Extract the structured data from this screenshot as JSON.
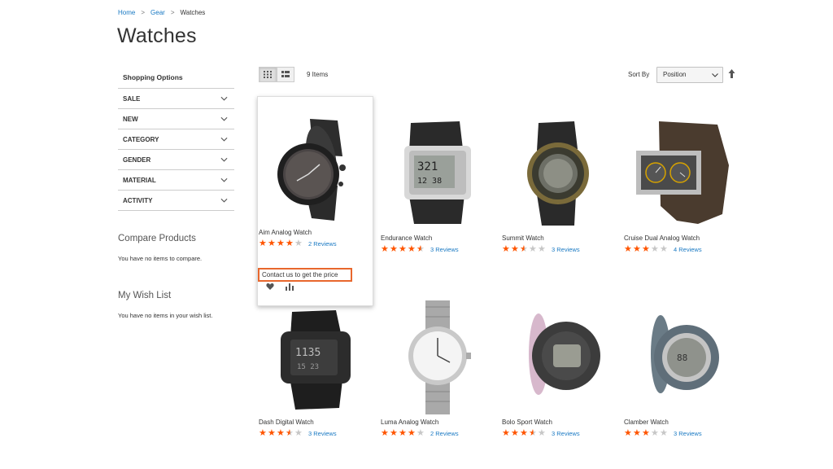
{
  "breadcrumb": {
    "home": "Home",
    "gear": "Gear",
    "current": "Watches",
    "separator": ">"
  },
  "page_title": "Watches",
  "sidebar": {
    "title": "Shopping Options",
    "filters": [
      "SALE",
      "NEW",
      "CATEGORY",
      "GENDER",
      "MATERIAL",
      "ACTIVITY"
    ],
    "compare_title": "Compare Products",
    "compare_text": "You have no items to compare.",
    "wishlist_title": "My Wish List",
    "wishlist_text": "You have no items in your wish list."
  },
  "toolbar": {
    "amount": "9 Items",
    "sort_label": "Sort By",
    "sort_value": "Position"
  },
  "products": [
    {
      "name": "Aim Analog Watch",
      "rating": 4,
      "reviews": "2 Reviews",
      "price_text": "Contact us to get the price"
    },
    {
      "name": "Endurance Watch",
      "rating": 4.5,
      "reviews": "3 Reviews"
    },
    {
      "name": "Summit Watch",
      "rating": 2.5,
      "reviews": "3 Reviews"
    },
    {
      "name": "Cruise Dual Analog Watch",
      "rating": 3,
      "reviews": "4 Reviews"
    },
    {
      "name": "Dash Digital Watch",
      "rating": 3.5,
      "reviews": "3 Reviews"
    },
    {
      "name": "Luma Analog Watch",
      "rating": 4,
      "reviews": "2 Reviews"
    },
    {
      "name": "Bolo Sport Watch",
      "rating": 3.5,
      "reviews": "3 Reviews"
    },
    {
      "name": "Clamber Watch",
      "rating": 3,
      "reviews": "3 Reviews"
    }
  ],
  "colors": {
    "accent_link": "#1979c3",
    "star": "#ff5501",
    "highlight_border": "#e8672d"
  }
}
